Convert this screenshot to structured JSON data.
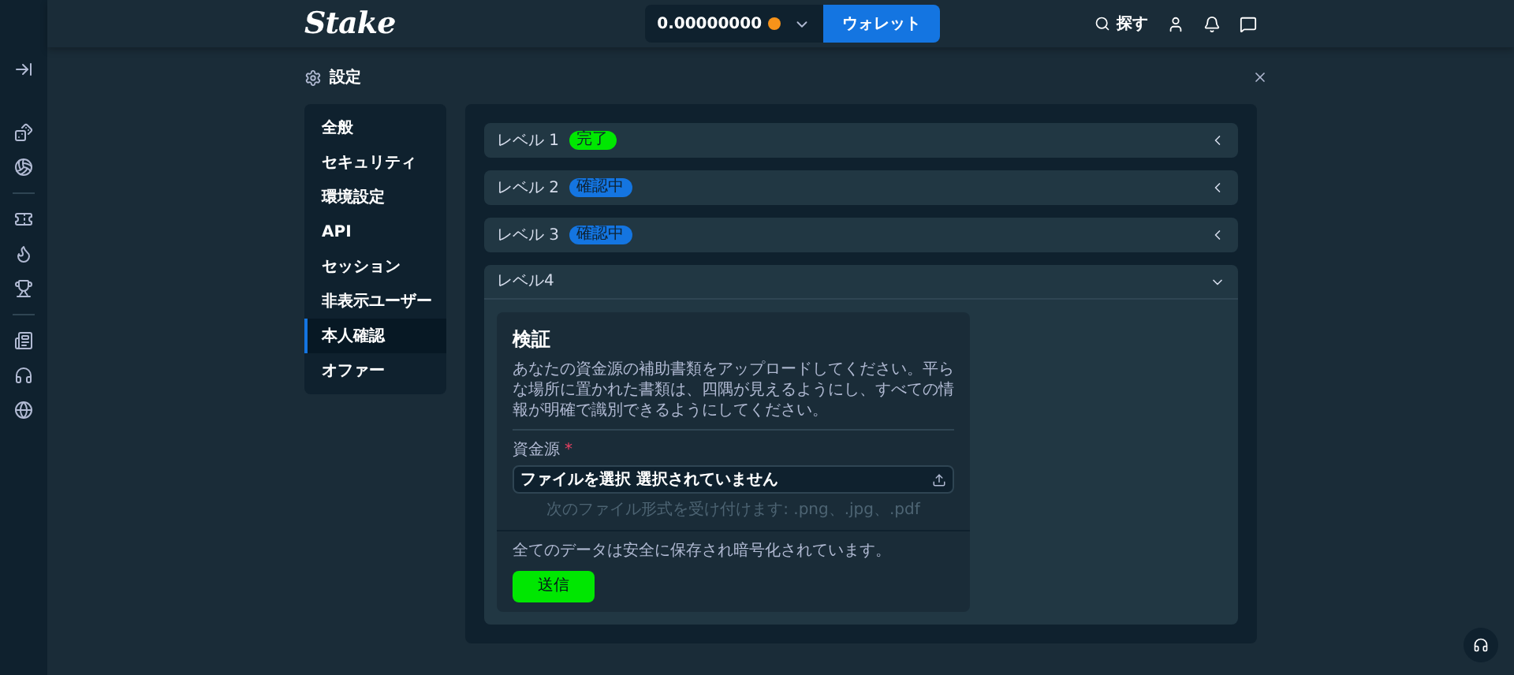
{
  "header": {
    "logo": "Stake",
    "balance": "0.00000000",
    "wallet_button": "ウォレット",
    "search_label": "探す"
  },
  "page": {
    "title": "設定"
  },
  "sidebar": {
    "items": [
      {
        "label": "全般",
        "selected": false
      },
      {
        "label": "セキュリティ",
        "selected": false
      },
      {
        "label": "環境設定",
        "selected": false
      },
      {
        "label": "API",
        "selected": false
      },
      {
        "label": "セッション",
        "selected": false
      },
      {
        "label": "非表示ユーザー",
        "selected": false
      },
      {
        "label": "本人確認",
        "selected": true
      },
      {
        "label": "オファー",
        "selected": false
      }
    ]
  },
  "levels": [
    {
      "title": "レベル 1",
      "badge": "完了",
      "color": "#00e701",
      "expanded": false
    },
    {
      "title": "レベル 2",
      "badge": "確認中",
      "color": "#1475e1",
      "expanded": false
    },
    {
      "title": "レベル 3",
      "badge": "確認中",
      "color": "#1475e1",
      "expanded": false
    },
    {
      "title": "レベル4",
      "expanded": true
    }
  ],
  "verification": {
    "title": "検証",
    "description": "あなたの資金源の補助書類をアップロードしてください。平らな場所に置かれた書類は、四隅が見えるようにし、すべての情報が明確で識別できるようにしてください。",
    "field_label": "資金源",
    "required_mark": "*",
    "file_value": "ファイルを選択 選択されていません",
    "hint": "次のファイル形式を受け付けます: .png、.jpg、.pdf",
    "footer_note": "全てのデータは安全に保存され暗号化されています。",
    "submit": "送信"
  }
}
